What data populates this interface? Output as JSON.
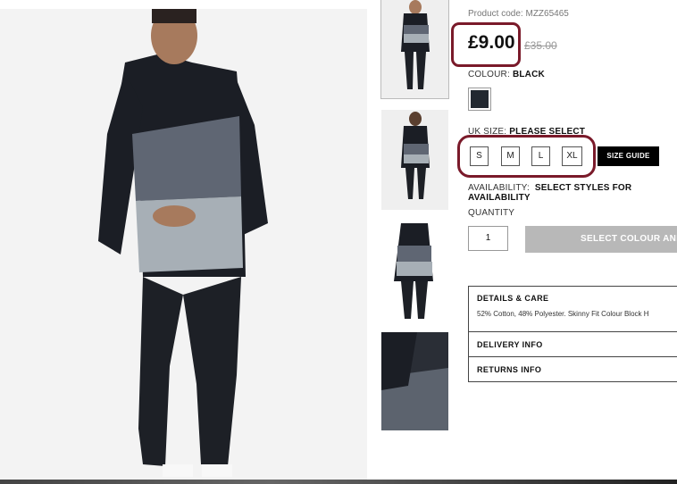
{
  "product": {
    "code": "Product code: MZZ65465",
    "price": "£9.00",
    "was_price": "£35.00"
  },
  "colour": {
    "label": "COLOUR:",
    "value": "BLACK",
    "swatch_color": "#222830"
  },
  "size": {
    "label": "UK SIZE:",
    "value": "PLEASE SELECT",
    "options": [
      "S",
      "M",
      "L",
      "XL"
    ],
    "guide_label": "SIZE GUIDE"
  },
  "availability": {
    "label": "AVAILABILITY:",
    "value": "SELECT STYLES FOR AVAILABILITY"
  },
  "quantity": {
    "label": "QUANTITY",
    "value": "1"
  },
  "add_button": "SELECT COLOUR AND",
  "accordion": {
    "details_title": "DETAILS & CARE",
    "details_text": "52% Cotton, 48% Polyester. Skinny Fit Colour Block H",
    "delivery_title": "DELIVERY INFO",
    "returns_title": "RETURNS INFO"
  },
  "highlight_color": "#7a1a2a"
}
